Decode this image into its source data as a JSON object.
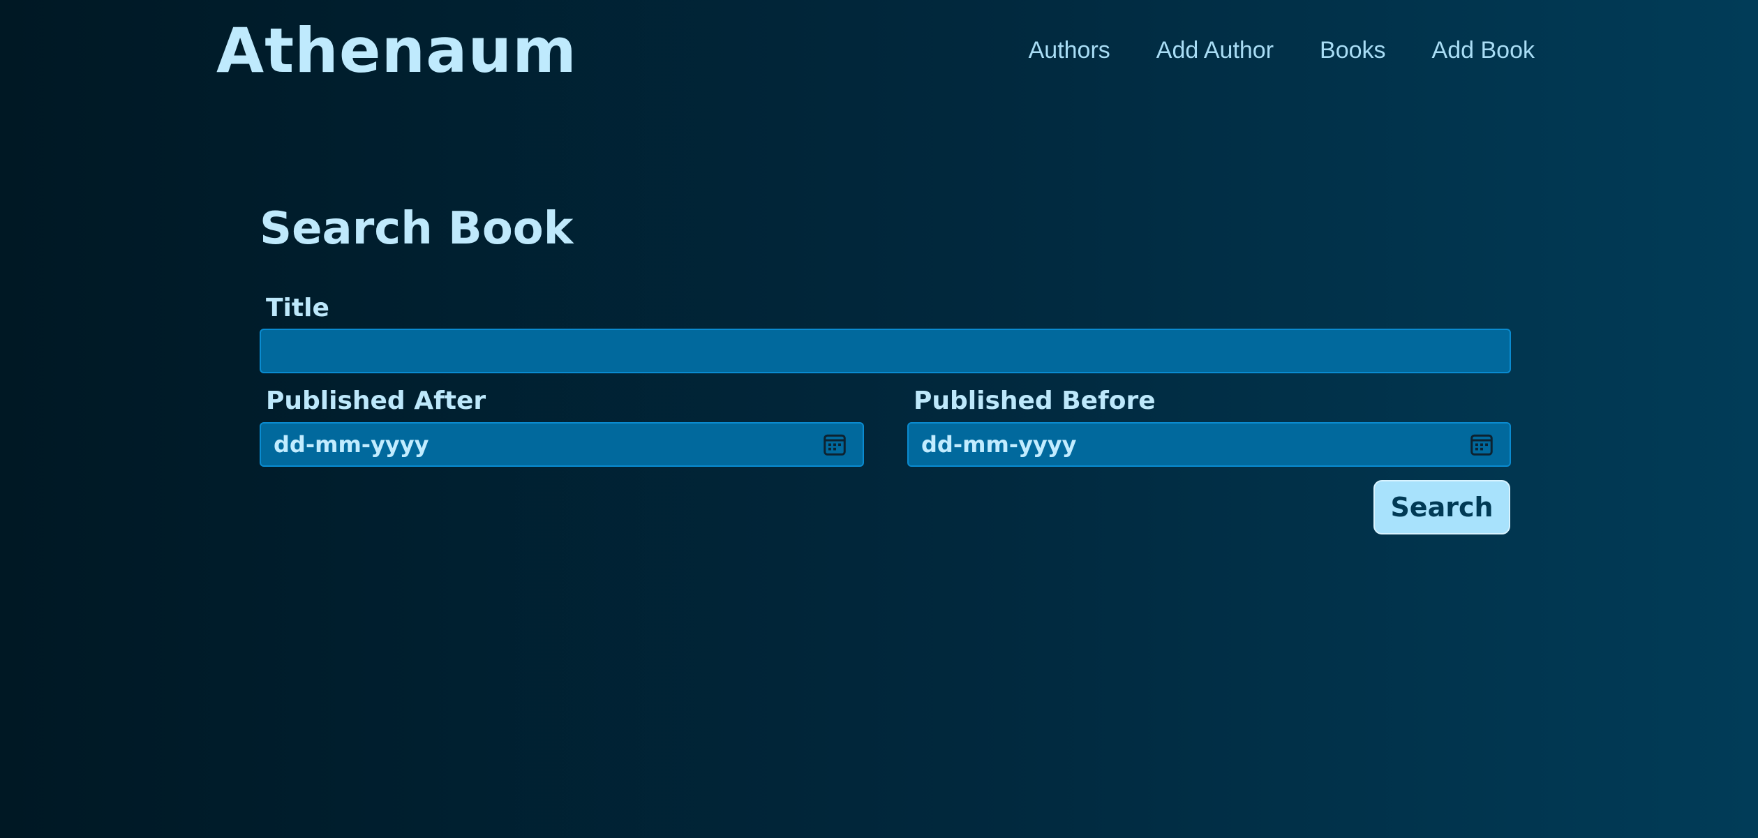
{
  "header": {
    "brand": "Athenaum",
    "nav": [
      "Authors",
      "Add Author",
      "Books",
      "Add Book"
    ]
  },
  "form": {
    "title": "Search Book",
    "title_field": {
      "label": "Title",
      "value": ""
    },
    "published_after": {
      "label": "Published After",
      "placeholder": "dd-mm-yyyy",
      "icon": "calendar-icon"
    },
    "published_before": {
      "label": "Published Before",
      "placeholder": "dd-mm-yyyy",
      "icon": "calendar-icon"
    },
    "submit_label": "Search"
  },
  "colors": {
    "background_dark": "#001824",
    "background_light": "#013c58",
    "field_bg": "#01699d",
    "accent": "#a8e2fc",
    "text": "#bfe9fc"
  }
}
